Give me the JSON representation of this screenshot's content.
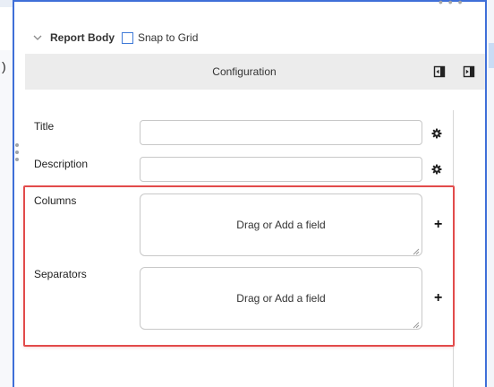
{
  "report_row": {
    "title": "Report Body",
    "snap_label": "Snap to Grid",
    "snap_checked": false
  },
  "config_bar": {
    "title": "Configuration",
    "icons": [
      "collapse-panel-icon",
      "expand-panel-icon"
    ]
  },
  "fields": {
    "title": {
      "label": "Title",
      "value": ""
    },
    "description": {
      "label": "Description",
      "value": ""
    },
    "columns": {
      "label": "Columns",
      "placeholder": "Drag or Add a field"
    },
    "separators": {
      "label": "Separators",
      "placeholder": "Drag or Add a field"
    }
  },
  "buttons": {
    "add_symbol": "+"
  },
  "misc": {
    "top_ellipsis": "• • •",
    "left_paren": ")"
  },
  "colors": {
    "accent_blue": "#3f6fd8",
    "highlight_red": "#e24b4b",
    "config_bar_bg": "#ececec"
  }
}
